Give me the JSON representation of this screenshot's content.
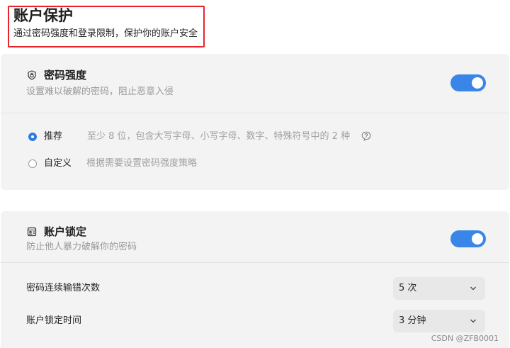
{
  "header": {
    "title": "账户保护",
    "subtitle": "通过密码强度和登录限制，保护你的账户安全"
  },
  "password_strength": {
    "icon": "shield-lock-icon",
    "title": "密码强度",
    "description": "设置难以破解的密码，阻止恶意入侵",
    "enabled": true,
    "options": [
      {
        "label": "推荐",
        "description": "至少 8 位，包含大写字母、小写字母、数字、特殊符号中的 2 种",
        "selected": true,
        "has_help": true
      },
      {
        "label": "自定义",
        "description": "根据需要设置密码强度策略",
        "selected": false,
        "has_help": false
      }
    ]
  },
  "account_lock": {
    "icon": "account-card-icon",
    "title": "账户锁定",
    "description": "防止他人暴力破解你的密码",
    "enabled": true,
    "rows": [
      {
        "label": "密码连续输错次数",
        "value": "5 次"
      },
      {
        "label": "账户锁定时间",
        "value": "3 分钟"
      }
    ]
  },
  "watermark": "CSDN @ZFB0001",
  "colors": {
    "accent": "#3a86e8",
    "highlight_border": "#e8232c",
    "card_bg": "#f3f3f3"
  }
}
